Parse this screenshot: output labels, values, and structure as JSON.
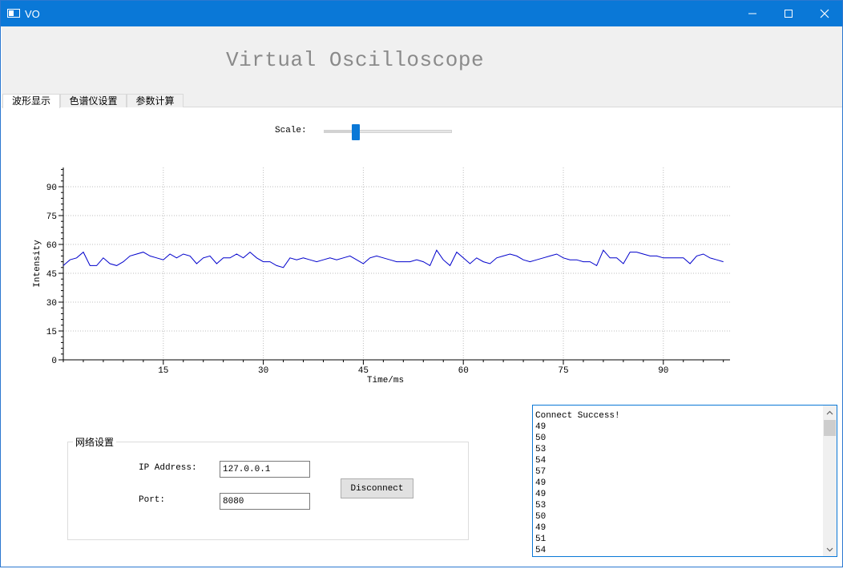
{
  "window": {
    "title": "VO",
    "icon": "window-app-icon",
    "controls": [
      "minimize-icon",
      "maximize-icon",
      "close-icon"
    ],
    "accent_color": "#0a78d7"
  },
  "header": {
    "title": "Virtual Oscilloscope"
  },
  "tabs": [
    {
      "label": "波形显示",
      "active": true
    },
    {
      "label": "色谱仪设置",
      "active": false
    },
    {
      "label": "参数计算",
      "active": false
    }
  ],
  "scale": {
    "label": "Scale:",
    "value_fraction": 0.25
  },
  "chart_data": {
    "type": "line",
    "title": "",
    "xlabel": "Time/ms",
    "ylabel": "Intensity",
    "xlim": [
      0,
      100
    ],
    "ylim": [
      0,
      100
    ],
    "x_ticks": [
      15,
      30,
      45,
      60,
      75,
      90
    ],
    "y_ticks": [
      0,
      15,
      30,
      45,
      60,
      75,
      90
    ],
    "grid": true,
    "line_color": "#0000cc",
    "series": [
      {
        "values": [
          49,
          52,
          53,
          56,
          49,
          49,
          53,
          50,
          49,
          51,
          54,
          55,
          56,
          54,
          53,
          52,
          55,
          53,
          55,
          54,
          50,
          53,
          54,
          50,
          53,
          53,
          55,
          53,
          56,
          53,
          51,
          51,
          49,
          48,
          53,
          52,
          53,
          52,
          51,
          52,
          53,
          52,
          53,
          54,
          52,
          50,
          53,
          54,
          53,
          52,
          51,
          51,
          51,
          52,
          51,
          49,
          57,
          52,
          49,
          56,
          53,
          50,
          53,
          51,
          50,
          53,
          54,
          55,
          54,
          52,
          51,
          52,
          53,
          54,
          55,
          53,
          52,
          52,
          51,
          51,
          49,
          57,
          53,
          53,
          50,
          56,
          56,
          55,
          54,
          54,
          53,
          53,
          53,
          53,
          50,
          54,
          55,
          53,
          52,
          51
        ]
      }
    ]
  },
  "network": {
    "group_title": "网络设置",
    "ip_label": "IP Address:",
    "ip_value": "127.0.0.1",
    "port_label": "Port:",
    "port_value": "8080",
    "disconnect_label": "Disconnect"
  },
  "log": {
    "lines": [
      "Connect Success!",
      "49",
      "50",
      "53",
      "54",
      "57",
      "49",
      "49",
      "53",
      "50",
      "49",
      "51",
      "54"
    ]
  }
}
